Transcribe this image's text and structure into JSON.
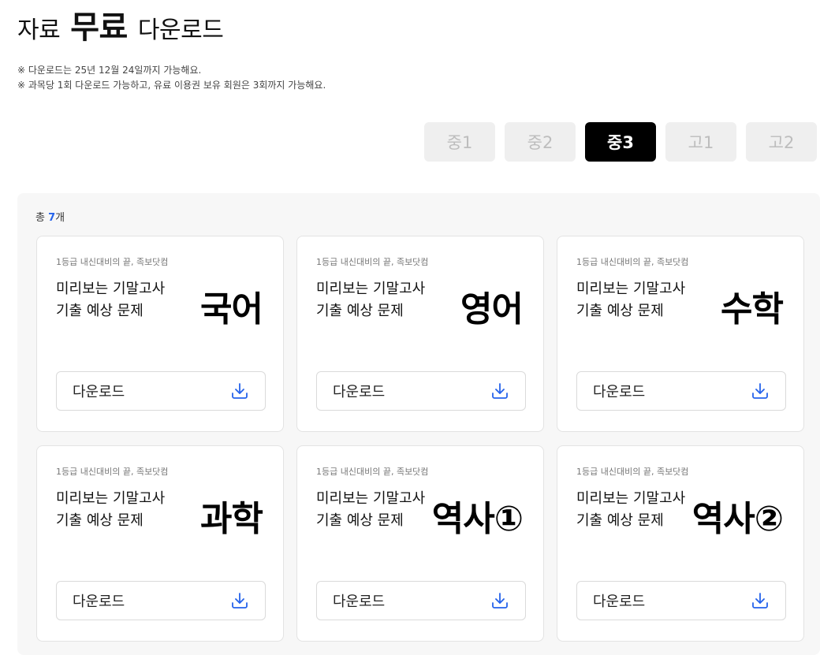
{
  "header": {
    "title_prefix": "자료",
    "title_bold": "무료",
    "title_suffix": "다운로드",
    "notes": [
      "※ 다운로드는 25년 12월 24일까지 가능해요.",
      "※ 과목당 1회 다운로드 가능하고, 유료 이용권 보유 회원은 3회까지 가능해요."
    ]
  },
  "grades": [
    {
      "label": "중1",
      "active": false
    },
    {
      "label": "중2",
      "active": false
    },
    {
      "label": "중3",
      "active": true
    },
    {
      "label": "고1",
      "active": false
    },
    {
      "label": "고2",
      "active": false
    }
  ],
  "summary": {
    "prefix": "총",
    "count": "7",
    "suffix": "개"
  },
  "cards": [
    {
      "tag": "1등급 내신대비의 끝, 족보닷컴",
      "line1": "미리보는 기말고사",
      "line2": "기출 예상 문제",
      "subject": "국어",
      "button": "다운로드"
    },
    {
      "tag": "1등급 내신대비의 끝, 족보닷컴",
      "line1": "미리보는 기말고사",
      "line2": "기출 예상 문제",
      "subject": "영어",
      "button": "다운로드"
    },
    {
      "tag": "1등급 내신대비의 끝, 족보닷컴",
      "line1": "미리보는 기말고사",
      "line2": "기출 예상 문제",
      "subject": "수학",
      "button": "다운로드"
    },
    {
      "tag": "1등급 내신대비의 끝, 족보닷컴",
      "line1": "미리보는 기말고사",
      "line2": "기출 예상 문제",
      "subject": "과학",
      "button": "다운로드"
    },
    {
      "tag": "1등급 내신대비의 끝, 족보닷컴",
      "line1": "미리보는 기말고사",
      "line2": "기출 예상 문제",
      "subject": "역사①",
      "button": "다운로드"
    },
    {
      "tag": "1등급 내신대비의 끝, 족보닷컴",
      "line1": "미리보는 기말고사",
      "line2": "기출 예상 문제",
      "subject": "역사②",
      "button": "다운로드"
    }
  ],
  "icons": {
    "download": "download-icon"
  },
  "colors": {
    "accent": "#2563eb",
    "active_tab": "#000000",
    "inactive_tab": "#efefef"
  }
}
